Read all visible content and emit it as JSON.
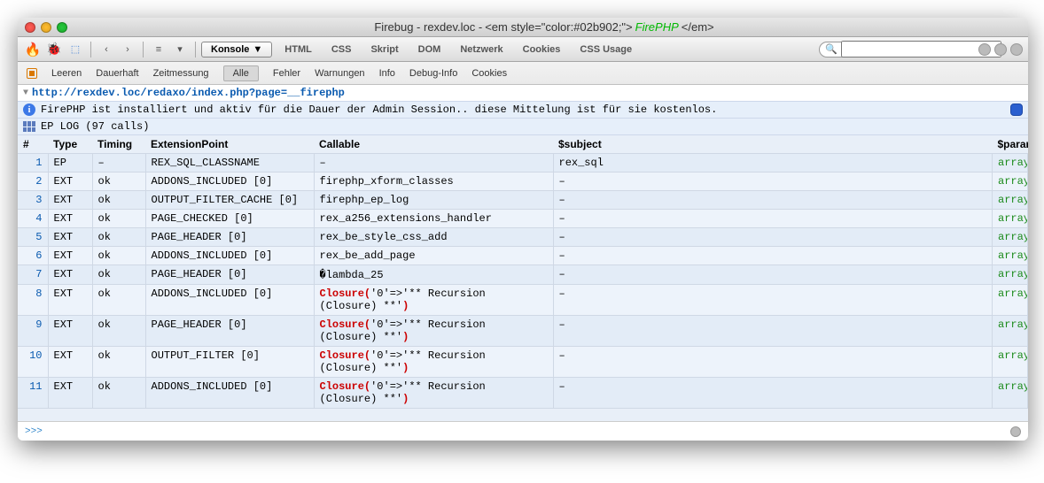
{
  "window": {
    "title_prefix": "Firebug - rexdev.loc - ",
    "title_markup_lt": "<em style=\"color:#02b902;\">",
    "title_firephp": "FirePHP",
    "title_markup_rt": "</em>"
  },
  "toolbar": {
    "console": "Konsole",
    "tabs": [
      "HTML",
      "CSS",
      "Skript",
      "DOM",
      "Netzwerk",
      "Cookies",
      "CSS Usage"
    ],
    "search_placeholder": ""
  },
  "subbar": {
    "items": [
      "Leeren",
      "Dauerhaft",
      "Zeitmessung"
    ],
    "filters": [
      "Alle",
      "Fehler",
      "Warnungen",
      "Info",
      "Debug-Info",
      "Cookies"
    ],
    "active": "Alle"
  },
  "request": {
    "url": "http://rexdev.loc/redaxo/index.php?page=__firephp"
  },
  "info": {
    "message": "FirePHP ist installiert und aktiv für die Dauer der Admin Session.. diese Mittelung ist für sie kostenlos."
  },
  "log": {
    "title": "EP LOG (97 calls)",
    "headers": [
      "#",
      "Type",
      "Timing",
      "ExtensionPoint",
      "Callable",
      "$subject",
      "$params"
    ],
    "rows": [
      {
        "n": "1",
        "type": "EP",
        "timing": "–",
        "ep": "REX_SQL_CLASSNAME",
        "call": "–",
        "subj": "rex_sql",
        "par": "array"
      },
      {
        "n": "2",
        "type": "EXT",
        "timing": "ok",
        "ep": "ADDONS_INCLUDED [0]",
        "call": "firephp_xform_classes",
        "subj": "–",
        "par": "array"
      },
      {
        "n": "3",
        "type": "EXT",
        "timing": "ok",
        "ep": "OUTPUT_FILTER_CACHE [0]",
        "call": "firephp_ep_log",
        "subj": "–",
        "par": "array"
      },
      {
        "n": "4",
        "type": "EXT",
        "timing": "ok",
        "ep": "PAGE_CHECKED [0]",
        "call": "rex_a256_extensions_handler",
        "subj": "–",
        "par": "array"
      },
      {
        "n": "5",
        "type": "EXT",
        "timing": "ok",
        "ep": "PAGE_HEADER [0]",
        "call": "rex_be_style_css_add",
        "subj": "–",
        "par": "array"
      },
      {
        "n": "6",
        "type": "EXT",
        "timing": "ok",
        "ep": "ADDONS_INCLUDED [0]",
        "call": "rex_be_add_page",
        "subj": "–",
        "par": "array"
      },
      {
        "n": "7",
        "type": "EXT",
        "timing": "ok",
        "ep": "PAGE_HEADER [0]",
        "call": "�lambda_25",
        "subj": "–",
        "par": "array"
      },
      {
        "n": "8",
        "type": "EXT",
        "timing": "ok",
        "ep": "ADDONS_INCLUDED [0]",
        "call_html": "<span class='red'>Closure(</span>'0'=>'** Recursion (Closure) **'<span class='red'>)</span>",
        "subj": "–",
        "par": "array"
      },
      {
        "n": "9",
        "type": "EXT",
        "timing": "ok",
        "ep": "PAGE_HEADER [0]",
        "call_html": "<span class='red'>Closure(</span>'0'=>'** Recursion (Closure) **'<span class='red'>)</span>",
        "subj": "–",
        "par": "array"
      },
      {
        "n": "10",
        "type": "EXT",
        "timing": "ok",
        "ep": "OUTPUT_FILTER [0]",
        "call_html": "<span class='red'>Closure(</span>'0'=>'** Recursion (Closure) **'<span class='red'>)</span>",
        "subj": "–",
        "par": "array"
      },
      {
        "n": "11",
        "type": "EXT",
        "timing": "ok",
        "ep": "ADDONS_INCLUDED [0]",
        "call_html": "<span class='red'>Closure(</span>'0'=>'** Recursion (Closure) **'<span class='red'>)</span>",
        "subj": "–",
        "par": "array"
      }
    ]
  },
  "cmd": {
    "prompt": ">>>"
  }
}
